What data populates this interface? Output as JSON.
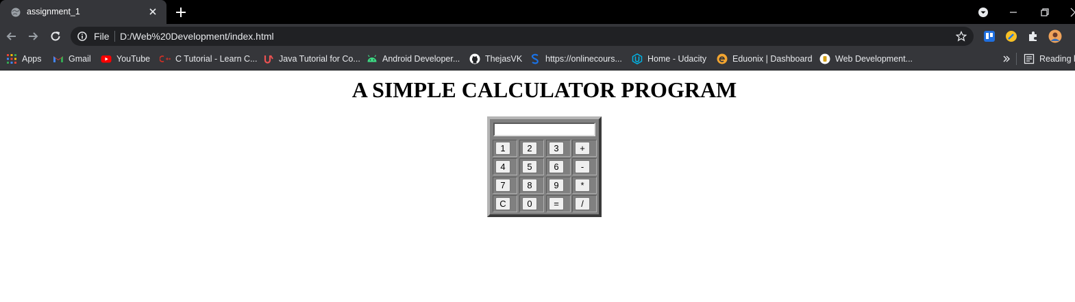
{
  "browser": {
    "tab": {
      "title": "assignment_1"
    },
    "address": {
      "scheme_label": "File",
      "url": "D:/Web%20Development/index.html"
    },
    "bookmarks": [
      {
        "label": "Apps",
        "icon": "apps-grid-icon"
      },
      {
        "label": "Gmail",
        "icon": "gmail-icon"
      },
      {
        "label": "YouTube",
        "icon": "youtube-icon"
      },
      {
        "label": "C Tutorial - Learn C...",
        "icon": "cpp-icon"
      },
      {
        "label": "Java Tutorial for Co...",
        "icon": "udemy-icon"
      },
      {
        "label": "Android Developer...",
        "icon": "android-icon"
      },
      {
        "label": "ThejasVK",
        "icon": "github-icon"
      },
      {
        "label": "https://onlinecours...",
        "icon": "s-logo-icon"
      },
      {
        "label": "Home - Udacity",
        "icon": "udacity-icon"
      },
      {
        "label": "Eduonix | Dashboard",
        "icon": "eduonix-icon"
      },
      {
        "label": "Web Development...",
        "icon": "web-dev-icon"
      }
    ],
    "reading_list_label": "Reading list"
  },
  "page": {
    "heading": "A SIMPLE CALCULATOR PROGRAM",
    "calculator": {
      "display_value": "",
      "rows": [
        [
          "1",
          "2",
          "3",
          "+"
        ],
        [
          "4",
          "5",
          "6",
          "-"
        ],
        [
          "7",
          "8",
          "9",
          "*"
        ],
        [
          "C",
          "0",
          "=",
          "/"
        ]
      ]
    }
  }
}
